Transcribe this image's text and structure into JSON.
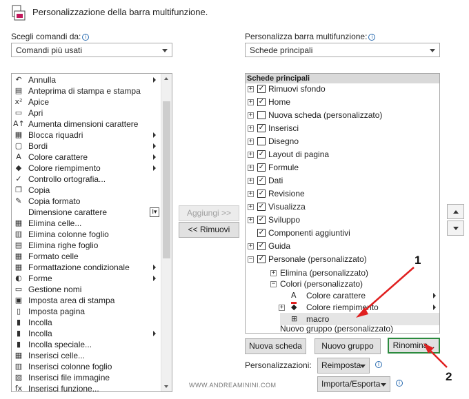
{
  "header": {
    "title": "Personalizzazione della barra multifunzione.",
    "icon": "ribbon-customize-icon"
  },
  "left": {
    "label": "Scegli comandi da:",
    "dropdown_value": "Comandi più usati",
    "items": [
      {
        "label": "Annulla",
        "icon": "undo-icon",
        "sub": true
      },
      {
        "label": "Anteprima di stampa e stampa",
        "icon": "print-preview-icon"
      },
      {
        "label": "Apice",
        "icon": "superscript-icon"
      },
      {
        "label": "Apri",
        "icon": "folder-open-icon"
      },
      {
        "label": "Aumenta dimensioni carattere",
        "icon": "increase-font-icon"
      },
      {
        "label": "Blocca riquadri",
        "icon": "freeze-panes-icon",
        "sub": true
      },
      {
        "label": "Bordi",
        "icon": "borders-icon",
        "sub": true
      },
      {
        "label": "Colore carattere",
        "icon": "font-color-icon",
        "sub": true
      },
      {
        "label": "Colore riempimento",
        "icon": "fill-color-icon",
        "sub": true
      },
      {
        "label": "Controllo ortografia...",
        "icon": "spelling-icon"
      },
      {
        "label": "Copia",
        "icon": "copy-icon"
      },
      {
        "label": "Copia formato",
        "icon": "format-painter-icon"
      },
      {
        "label": "Dimensione carattere",
        "icon": "",
        "sizebox": true
      },
      {
        "label": "Elimina celle...",
        "icon": "delete-cells-icon"
      },
      {
        "label": "Elimina colonne foglio",
        "icon": "delete-columns-icon"
      },
      {
        "label": "Elimina righe foglio",
        "icon": "delete-rows-icon"
      },
      {
        "label": "Formato celle",
        "icon": "format-cells-icon"
      },
      {
        "label": "Formattazione condizionale",
        "icon": "conditional-format-icon",
        "sub": true
      },
      {
        "label": "Forme",
        "icon": "shapes-icon",
        "sub": true
      },
      {
        "label": "Gestione nomi",
        "icon": "name-manager-icon"
      },
      {
        "label": "Imposta area di stampa",
        "icon": "print-area-icon"
      },
      {
        "label": "Imposta pagina",
        "icon": "page-setup-icon"
      },
      {
        "label": "Incolla",
        "icon": "paste-icon"
      },
      {
        "label": "Incolla",
        "icon": "paste-icon",
        "sub": true
      },
      {
        "label": "Incolla speciale...",
        "icon": "paste-special-icon"
      },
      {
        "label": "Inserisci celle...",
        "icon": "insert-cells-icon"
      },
      {
        "label": "Inserisci colonne foglio",
        "icon": "insert-columns-icon"
      },
      {
        "label": "Inserisci file immagine",
        "icon": "insert-picture-icon"
      },
      {
        "label": "Inserisci funzione...",
        "icon": "insert-function-icon"
      }
    ]
  },
  "middle": {
    "add_label": "Aggiungi >>",
    "remove_label": "<< Rimuovi"
  },
  "right": {
    "label": "Personalizza barra multifunzione:",
    "dropdown_value": "Schede principali",
    "tree_header": "Schede principali",
    "tree": [
      {
        "label": "Rimuovi sfondo",
        "checked": true,
        "exp": "+"
      },
      {
        "label": "Home",
        "checked": true,
        "exp": "+"
      },
      {
        "label": "Nuova scheda (personalizzato)",
        "checked": false,
        "exp": "+"
      },
      {
        "label": "Inserisci",
        "checked": true,
        "exp": "+"
      },
      {
        "label": "Disegno",
        "checked": false,
        "exp": "+"
      },
      {
        "label": "Layout di pagina",
        "checked": true,
        "exp": "+"
      },
      {
        "label": "Formule",
        "checked": true,
        "exp": "+"
      },
      {
        "label": "Dati",
        "checked": true,
        "exp": "+"
      },
      {
        "label": "Revisione",
        "checked": true,
        "exp": "+"
      },
      {
        "label": "Visualizza",
        "checked": true,
        "exp": "+"
      },
      {
        "label": "Sviluppo",
        "checked": true,
        "exp": "+"
      },
      {
        "label": "Componenti aggiuntivi",
        "checked": true,
        "exp": ""
      },
      {
        "label": "Guida",
        "checked": true,
        "exp": "+"
      },
      {
        "label": "Personale (personalizzato)",
        "checked": true,
        "exp": "−"
      }
    ],
    "sub_groups": [
      {
        "label": "Elimina (personalizzato)",
        "exp": "+"
      },
      {
        "label": "Colori (personalizzato)",
        "exp": "−"
      }
    ],
    "sub_items": [
      {
        "label": "Colore carattere",
        "icon": "font-color-icon"
      },
      {
        "label": "Colore riempimento",
        "icon": "fill-color-icon"
      },
      {
        "label": "macro",
        "icon": "macro-icon"
      }
    ],
    "last_group": "Nuovo gruppo (personalizzato)",
    "buttons": {
      "new_tab": "Nuova scheda",
      "new_group": "Nuovo gruppo",
      "rename": "Rinomina..."
    },
    "personalizations_label": "Personalizzazioni:",
    "reset_label": "Reimposta",
    "import_export_label": "Importa/Esporta"
  },
  "watermark": "WWW.ANDREAMININI.COM",
  "annotations": {
    "one": "1",
    "two": "2"
  },
  "colors": {
    "arrow": "#e02020",
    "checkmark": "#1a1a1a",
    "focus_border": "#2b8a3e"
  }
}
